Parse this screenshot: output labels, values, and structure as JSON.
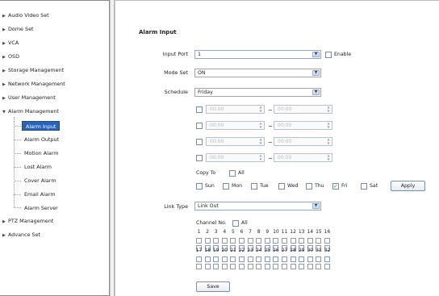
{
  "sidebar": {
    "items": [
      {
        "label": "Audio Video Set",
        "expanded": false
      },
      {
        "label": "Dome Set",
        "expanded": false
      },
      {
        "label": "VCA",
        "expanded": false
      },
      {
        "label": "OSD",
        "expanded": false
      },
      {
        "label": "Storage Management",
        "expanded": false
      },
      {
        "label": "Network Management",
        "expanded": false
      },
      {
        "label": "User Management",
        "expanded": false
      },
      {
        "label": "Alarm Management",
        "expanded": true
      },
      {
        "label": "PTZ Management",
        "expanded": false
      },
      {
        "label": "Advance Set",
        "expanded": false
      }
    ],
    "alarm_subitems": [
      "Alarm Input",
      "Alarm Output",
      "Motion Alarm",
      "Lost Alarm",
      "Cover Alarm",
      "Email Alarm",
      "Alarm Server"
    ],
    "active_subitem": "Alarm Input",
    "active_color": "#2c63b5"
  },
  "main": {
    "title": "Alarm Input",
    "input_port": {
      "label": "Input Port",
      "value": "1",
      "enable_label": "Enable",
      "enabled": false
    },
    "mode_set": {
      "label": "Mode Set",
      "value": "ON"
    },
    "schedule": {
      "label": "Schedule",
      "value": "Friday",
      "periods": [
        {
          "start": "00:00",
          "end": "00:00",
          "checked": false
        },
        {
          "start": "00:00",
          "end": "00:00",
          "checked": false
        },
        {
          "start": "00:00",
          "end": "00:00",
          "checked": false
        },
        {
          "start": "00:00",
          "end": "00:00",
          "checked": false
        }
      ],
      "separator": "~"
    },
    "copy_to": {
      "label": "Copy To",
      "all_label": "All",
      "days": [
        {
          "label": "Sun",
          "checked": false
        },
        {
          "label": "Mon",
          "checked": false
        },
        {
          "label": "Tue",
          "checked": false
        },
        {
          "label": "Wed",
          "checked": false
        },
        {
          "label": "Thu",
          "checked": false
        },
        {
          "label": "Fri",
          "checked": true
        },
        {
          "label": "Sat",
          "checked": false
        }
      ],
      "apply_label": "Apply"
    },
    "link_type": {
      "label": "Link Type",
      "value": "Link Out"
    },
    "channel": {
      "label": "Channel No.",
      "all_label": "All",
      "row1": [
        "1",
        "2",
        "3",
        "4",
        "5",
        "6",
        "7",
        "8",
        "9",
        "10",
        "11",
        "12",
        "13",
        "14",
        "15",
        "16"
      ],
      "row2": [
        "17",
        "18",
        "19",
        "20",
        "21",
        "22",
        "23",
        "24",
        "25",
        "26",
        "27",
        "28",
        "29",
        "30",
        "31",
        "32"
      ]
    },
    "save_label": "Save",
    "icons": {
      "dropdown": "chevron-down-icon",
      "checkmark": "check-icon",
      "expand": "triangle-right-icon",
      "collapse": "triangle-down-icon"
    }
  }
}
